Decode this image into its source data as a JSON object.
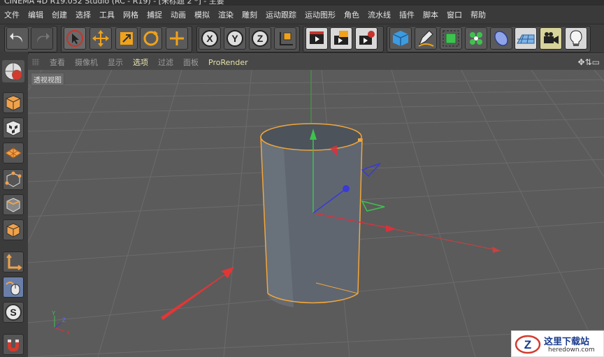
{
  "app": {
    "title": "CINEMA 4D R19.052 Studio (RC - R19) - [未标题 2 *] - 主要"
  },
  "menu": [
    "文件",
    "编辑",
    "创建",
    "选择",
    "工具",
    "网格",
    "捕捉",
    "动画",
    "模拟",
    "渲染",
    "雕刻",
    "运动跟踪",
    "运动图形",
    "角色",
    "流水线",
    "插件",
    "脚本",
    "窗口",
    "帮助"
  ],
  "toolbar": {
    "icons": [
      "undo-icon",
      "redo-icon",
      "live-selection-icon",
      "move-icon",
      "scale-icon",
      "rotate-icon",
      "recent-tool-icon",
      "x-axis-lock-icon",
      "y-axis-lock-icon",
      "z-axis-lock-icon",
      "coordinate-system-icon",
      "render-view-icon",
      "render-to-picture-viewer-icon",
      "render-settings-icon",
      "cube-icon",
      "pen-icon",
      "subdivision-surface-icon",
      "cloner-icon",
      "deformer-icon",
      "floor-icon",
      "camera-icon",
      "light-icon"
    ],
    "axis_labels": {
      "x": "X",
      "y": "Y",
      "z": "Z"
    }
  },
  "viewport_menu": [
    "查看",
    "摄像机",
    "显示",
    "选项",
    "过滤",
    "面板",
    "ProRender"
  ],
  "viewport_menu_selected": "选项",
  "viewport": {
    "label": "透视视图"
  },
  "left_tools": [
    "model-mode-icon",
    "texture-mode-icon",
    "workplane-mode-icon",
    "points-mode-icon",
    "edges-mode-icon",
    "polygons-mode-icon",
    "axis-mode-icon",
    "tweak-mode-icon",
    "solo-icon",
    "snap-icon"
  ],
  "axis_gizmo": {
    "x": "X",
    "y": "Y",
    "z": "Z"
  },
  "watermark": {
    "text": "这里下载站",
    "url": "heredown.com",
    "logo_letter": "Z"
  },
  "colors": {
    "accent_selected": "#e9e4b0",
    "object_highlight": "#f2a63a",
    "axis_x": "#d6333d",
    "axis_y": "#33c23d",
    "axis_z": "#3a3ad6"
  }
}
